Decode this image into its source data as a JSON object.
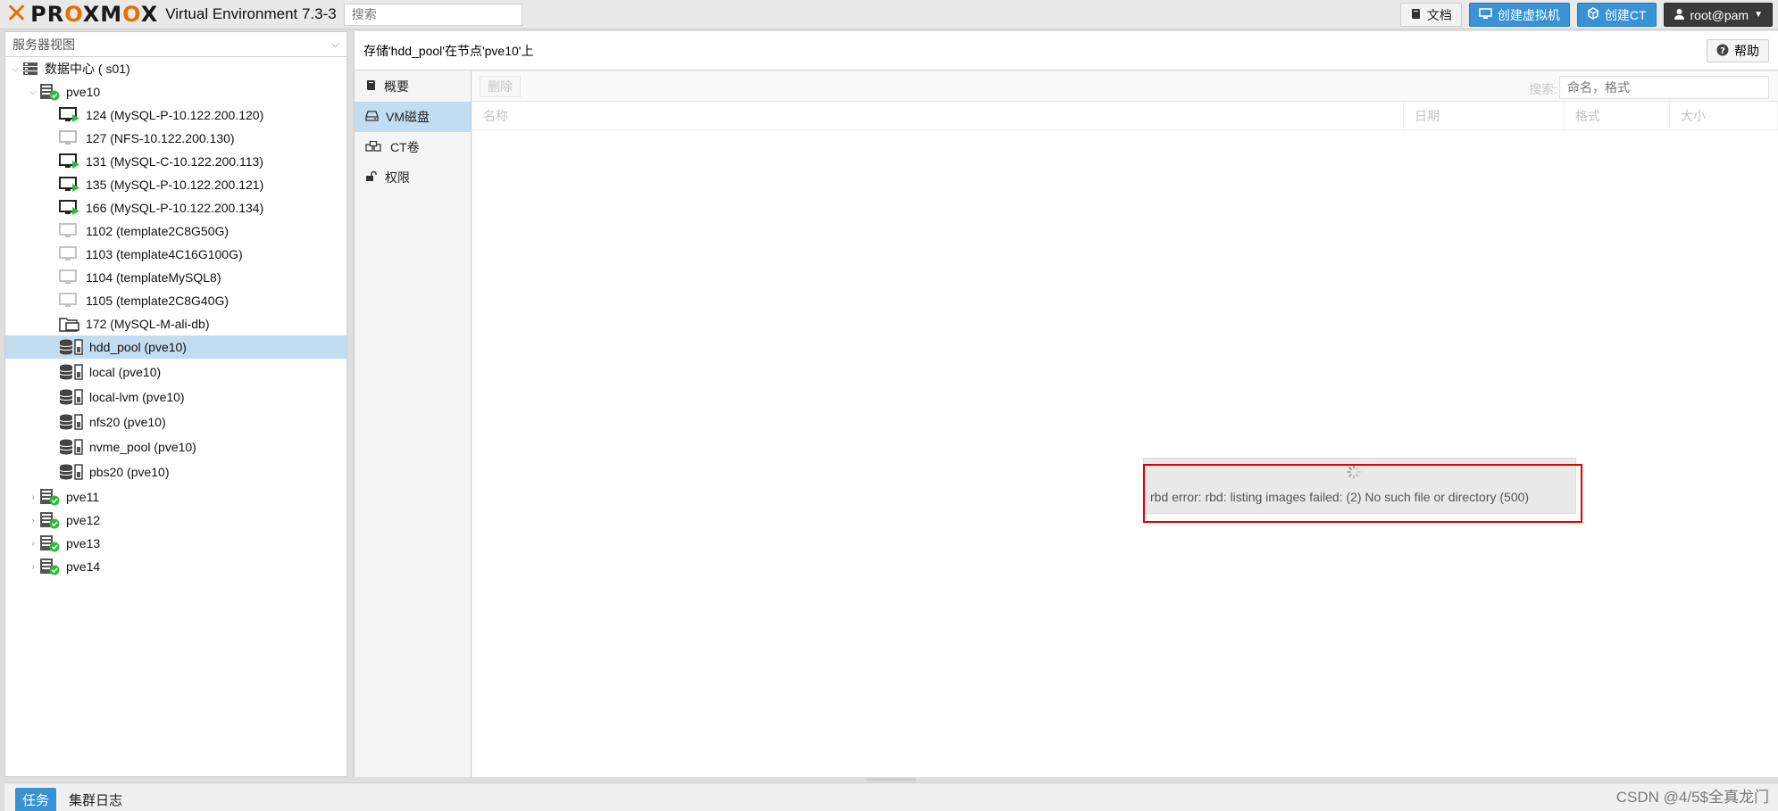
{
  "header": {
    "logo_text": "PROXMOX",
    "version": "Virtual Environment 7.3-3",
    "search_placeholder": "搜索",
    "docs_label": "文档",
    "create_vm_label": "创建虚拟机",
    "create_ct_label": "创建CT",
    "user_label": "root@pam"
  },
  "sidebar": {
    "view_label": "服务器视图",
    "datacenter": "数据中心 (          s01)",
    "nodes": [
      {
        "label": "pve10",
        "expanded": true
      },
      {
        "label": "pve11"
      },
      {
        "label": "pve12"
      },
      {
        "label": "pve13"
      },
      {
        "label": "pve14"
      }
    ],
    "guests": [
      {
        "label": "124 (MySQL-P-10.122.200.120)",
        "status": "running"
      },
      {
        "label": "127 (NFS-10.122.200.130)",
        "status": "stopped"
      },
      {
        "label": "131 (MySQL-C-10.122.200.113)",
        "status": "running"
      },
      {
        "label": "135 (MySQL-P-10.122.200.121)",
        "status": "running"
      },
      {
        "label": "166 (MySQL-P-10.122.200.134)",
        "status": "running"
      },
      {
        "label": "1102 (template2C8G50G)",
        "status": "template"
      },
      {
        "label": "1103 (template4C16G100G)",
        "status": "template"
      },
      {
        "label": "1104 (templateMySQL8)",
        "status": "template"
      },
      {
        "label": "1105 (template2C8G40G)",
        "status": "template"
      },
      {
        "label": "172 (MySQL-M-ali-db)",
        "status": "container"
      }
    ],
    "storages": [
      {
        "label": "hdd_pool (pve10)",
        "selected": true
      },
      {
        "label": "local (pve10)"
      },
      {
        "label": "local-lvm (pve10)"
      },
      {
        "label": "nfs20 (pve10)"
      },
      {
        "label": "nvme_pool (pve10)"
      },
      {
        "label": "pbs20 (pve10)"
      }
    ]
  },
  "content": {
    "title": "存储'hdd_pool'在节点'pve10'上",
    "help_label": "帮助",
    "subnav": [
      {
        "label": "概要",
        "icon": "book-icon"
      },
      {
        "label": "VM磁盘",
        "icon": "hdd-icon",
        "active": true
      },
      {
        "label": "CT卷",
        "icon": "cubes-icon"
      },
      {
        "label": "权限",
        "icon": "unlock-icon"
      }
    ],
    "toolbar": {
      "delete_label": "删除",
      "search_label": "搜索:",
      "search_placeholder": "命名，格式"
    },
    "columns": [
      "名称",
      "日期",
      "格式",
      "大小"
    ],
    "error_message": "rbd error: rbd: listing images failed: (2) No such file or directory (500)"
  },
  "footer": {
    "tabs": [
      {
        "label": "任务",
        "active": true
      },
      {
        "label": "集群日志"
      }
    ],
    "watermark": "CSDN @4/5$全真龙门"
  },
  "colors": {
    "accent": "#3892d4",
    "brand": "#e57000",
    "selected_row": "#c2ddf2",
    "error_border": "#e00000",
    "running_green": "#2dbb3a"
  }
}
